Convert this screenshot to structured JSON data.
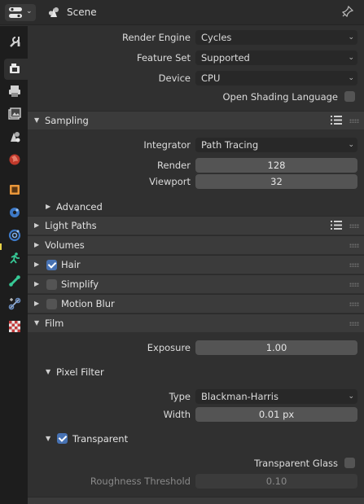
{
  "header": {
    "title": "Scene"
  },
  "tabs": [
    "tool",
    "render",
    "output",
    "view-layer",
    "scene",
    "world",
    "object",
    "modifiers",
    "particles",
    "physics",
    "constraints",
    "data",
    "texture"
  ],
  "render": {
    "engine_label": "Render Engine",
    "engine_value": "Cycles",
    "feature_label": "Feature Set",
    "feature_value": "Supported",
    "device_label": "Device",
    "device_value": "CPU",
    "osl_label": "Open Shading Language"
  },
  "sampling": {
    "title": "Sampling",
    "integrator_label": "Integrator",
    "integrator_value": "Path Tracing",
    "render_label": "Render",
    "render_value": "128",
    "viewport_label": "Viewport",
    "viewport_value": "32",
    "advanced_title": "Advanced"
  },
  "light_paths": {
    "title": "Light Paths"
  },
  "volumes": {
    "title": "Volumes"
  },
  "hair": {
    "title": "Hair",
    "checked": true
  },
  "simplify": {
    "title": "Simplify",
    "checked": false
  },
  "motion_blur": {
    "title": "Motion Blur",
    "checked": false
  },
  "film": {
    "title": "Film",
    "exposure_label": "Exposure",
    "exposure_value": "1.00",
    "pixel_filter_title": "Pixel Filter",
    "type_label": "Type",
    "type_value": "Blackman-Harris",
    "width_label": "Width",
    "width_value": "0.01 px",
    "transparent_title": "Transparent",
    "transparent_checked": true,
    "transparent_glass_label": "Transparent Glass",
    "roughness_label": "Roughness Threshold",
    "roughness_value": "0.10"
  },
  "colors": {
    "accent": "#4772b3",
    "panel": "#3b3b3b",
    "background": "#303030",
    "sidebar": "#1d1d1d"
  }
}
